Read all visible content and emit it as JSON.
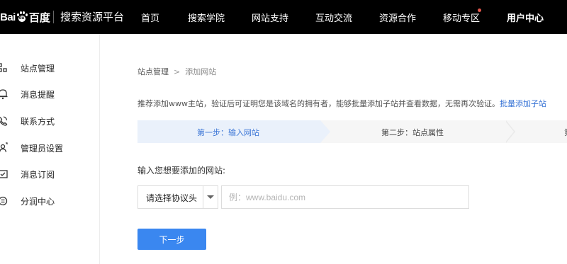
{
  "header": {
    "logo": {
      "bai": "Bai",
      "du": "du",
      "cn": "百度",
      "pad_text": "du"
    },
    "product_name": "搜索资源平台",
    "nav": [
      {
        "label": "首页"
      },
      {
        "label": "搜索学院"
      },
      {
        "label": "网站支持"
      },
      {
        "label": "互动交流"
      },
      {
        "label": "资源合作"
      },
      {
        "label": "移动专区"
      },
      {
        "label": "用户中心"
      }
    ],
    "notification_dot_color": "#e2574c"
  },
  "sidebar": {
    "items": [
      {
        "label": "站点管理",
        "icon": "site-management-icon"
      },
      {
        "label": "消息提醒",
        "icon": "bell-icon"
      },
      {
        "label": "联系方式",
        "icon": "phone-icon"
      },
      {
        "label": "管理员设置",
        "icon": "admin-user-icon"
      },
      {
        "label": "消息订阅",
        "icon": "subscription-icon"
      },
      {
        "label": "分润中心",
        "icon": "revenue-share-icon"
      }
    ]
  },
  "breadcrumb": {
    "parent": "站点管理",
    "separator": ">",
    "current": "添加网站"
  },
  "intro": {
    "text": "推荐添加www主站，验证后可证明您是该域名的拥有者，能够批量添加子站并查看数据，无需再次验证。",
    "link": "批量添加子站"
  },
  "steps": {
    "step1": "第一步：输入网站",
    "step2": "第二步：站点属性",
    "step3_partial": "第"
  },
  "form": {
    "label": "输入您想要添加的网站:",
    "protocol_value": "请选择协议头",
    "site_placeholder": "例：www.baidu.com",
    "next_button": "下一步"
  },
  "colors": {
    "accent": "#3a87f0",
    "link": "#3a75d6",
    "topbar": "#000000",
    "active_step_bg": "#eaf1fb"
  }
}
